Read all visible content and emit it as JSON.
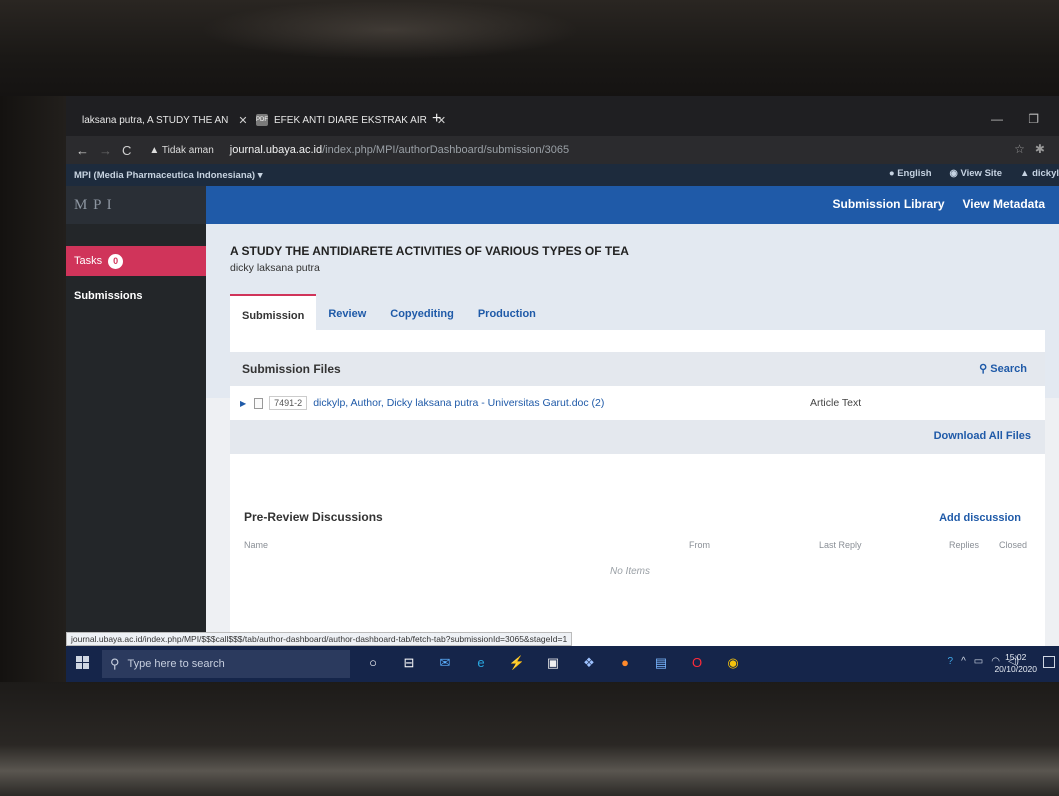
{
  "browser": {
    "tabs": [
      {
        "title": "laksana putra, A STUDY THE AN"
      },
      {
        "title": "EFEK ANTI DIARE EKSTRAK AIR"
      }
    ],
    "tab2_favicon_text": "PDF",
    "security_label": "Tidak aman",
    "url_host": "journal.ubaya.ac.id",
    "url_path": "/index.php/MPI/authorDashboard/submission/3065",
    "status_url": "journal.ubaya.ac.id/index.php/MPI/$$$call$$$/tab/author-dashboard/author-dashboard-tab/fetch-tab?submissionId=3065&stageId=1"
  },
  "context_bar": {
    "journal_name": "MPI (Media Pharmaceutica Indonesiana)",
    "language": "English",
    "view_site": "View Site",
    "user": "dickyl"
  },
  "header": {
    "logo_text": "M P I",
    "links": [
      "Submission Library",
      "View Metadata"
    ]
  },
  "sidebar": {
    "tasks_label": "Tasks",
    "tasks_count": "0",
    "submissions_label": "Submissions"
  },
  "submission": {
    "title": "A STUDY THE ANTIDIARETE ACTIVITIES OF VARIOUS TYPES OF TEA",
    "author": "dicky laksana putra",
    "tabs": [
      "Submission",
      "Review",
      "Copyediting",
      "Production"
    ],
    "active_tab": "Submission"
  },
  "files": {
    "heading": "Submission Files",
    "search_label": "Search",
    "file_id": "7491-2",
    "file_name": "dickylp, Author, Dicky laksana putra - Universitas Garut.doc (2)",
    "file_type": "Article Text",
    "download_all": "Download All Files"
  },
  "discussions": {
    "heading": "Pre-Review Discussions",
    "add_label": "Add discussion",
    "columns": [
      "Name",
      "From",
      "Last Reply",
      "Replies",
      "Closed"
    ],
    "empty_text": "No Items"
  },
  "taskbar": {
    "search_placeholder": "Type here to search",
    "time": "15:02",
    "date": "20/10/2020"
  },
  "colors": {
    "header_blue": "#1f5aa8",
    "tasks_pink": "#d0345a",
    "sidebar_dark": "#232629",
    "taskbar_navy": "#15254a"
  }
}
